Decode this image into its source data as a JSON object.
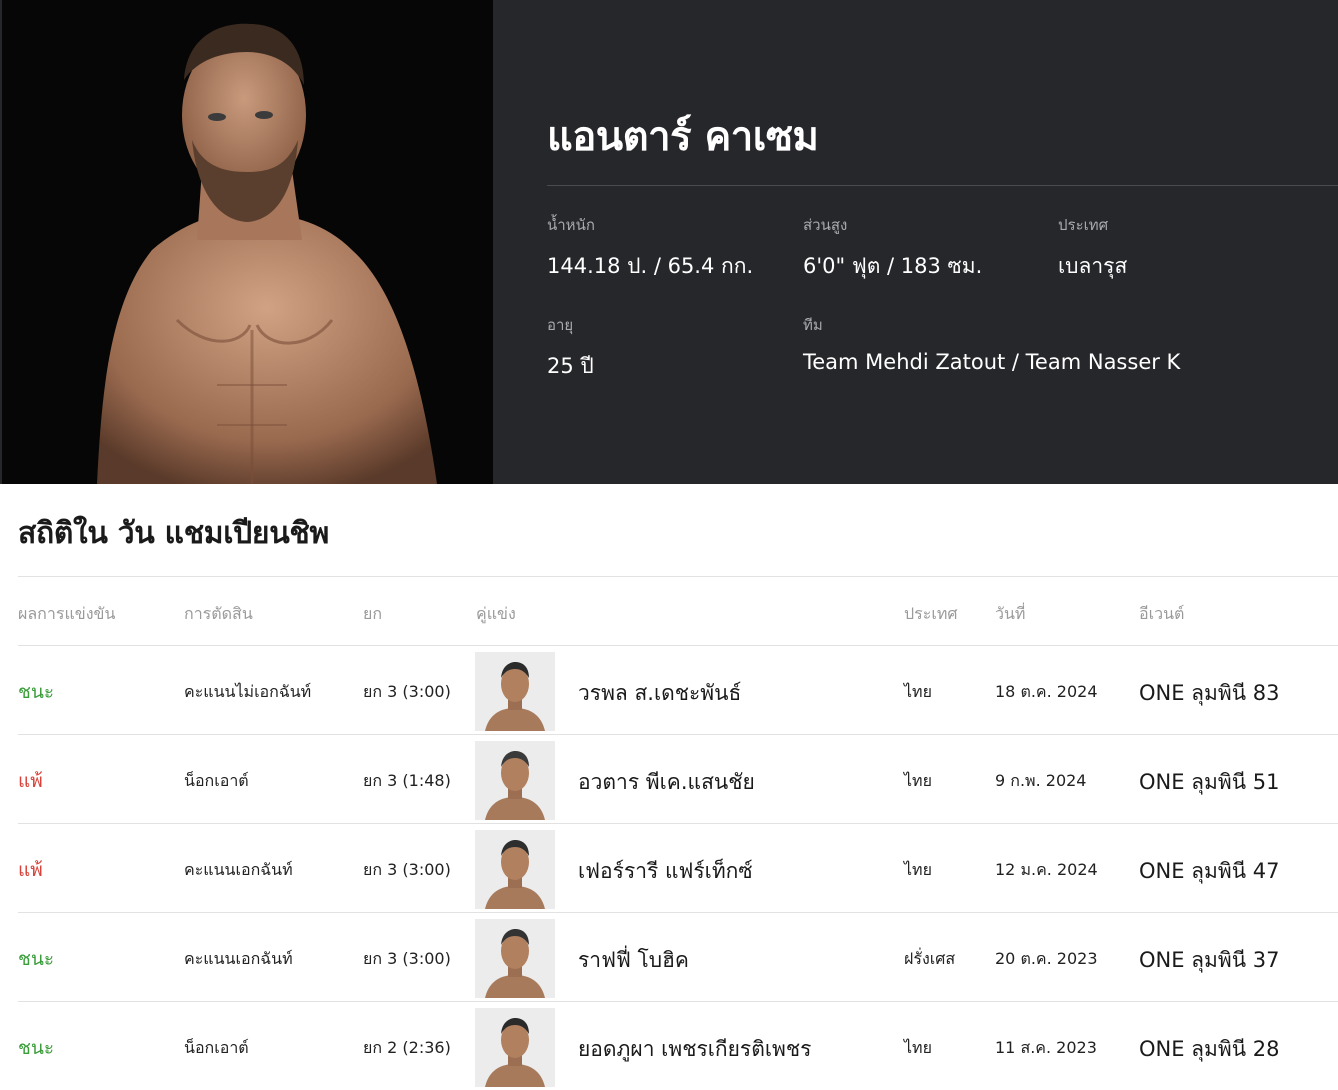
{
  "fighter": {
    "name": "แอนตาร์ คาเซม",
    "photo_alt": "fighter-portrait"
  },
  "stats": {
    "weight": {
      "label": "น้ำหนัก",
      "value": "144.18 ป. / 65.4 กก."
    },
    "height": {
      "label": "ส่วนสูง",
      "value": "6'0\" ฟุต / 183 ซม."
    },
    "country": {
      "label": "ประเทศ",
      "value": "เบลารุส"
    },
    "age": {
      "label": "อายุ",
      "value": "25 ปี"
    },
    "team": {
      "label": "ทีม",
      "value": "Team Mehdi Zatout / Team Nasser K"
    }
  },
  "record": {
    "title": "สถิติใน วัน แชมเปียนชิพ",
    "headers": {
      "result": "ผลการแข่งขัน",
      "method": "การตัดสิน",
      "round": "ยก",
      "opponent": "คู่แข่ง",
      "country": "ประเทศ",
      "date": "วันที่",
      "event": "อีเวนต์"
    },
    "rows": [
      {
        "result": "ชนะ",
        "result_type": "win",
        "method": "คะแนนไม่เอกฉันท์",
        "round": "ยก 3 (3:00)",
        "opponent": "วรพล ส.เดชะพันธ์",
        "country": "ไทย",
        "date": "18 ต.ค. 2024",
        "event": "ONE ลุมพินี 83"
      },
      {
        "result": "แพ้",
        "result_type": "loss",
        "method": "น็อกเอาต์",
        "round": "ยก 3 (1:48)",
        "opponent": "อวตาร พีเค.แสนชัย",
        "country": "ไทย",
        "date": "9 ก.พ. 2024",
        "event": "ONE ลุมพินี 51"
      },
      {
        "result": "แพ้",
        "result_type": "loss",
        "method": "คะแนนเอกฉันท์",
        "round": "ยก 3 (3:00)",
        "opponent": "เฟอร์รารี แฟร์เท็กซ์",
        "country": "ไทย",
        "date": "12 ม.ค. 2024",
        "event": "ONE ลุมพินี 47"
      },
      {
        "result": "ชนะ",
        "result_type": "win",
        "method": "คะแนนเอกฉันท์",
        "round": "ยก 3 (3:00)",
        "opponent": "ราฟฟี่ โบฮิค",
        "country": "ฝรั่งเศส",
        "date": "20 ต.ค. 2023",
        "event": "ONE ลุมพินี 37"
      },
      {
        "result": "ชนะ",
        "result_type": "win",
        "method": "น็อกเอาต์",
        "round": "ยก 2 (2:36)",
        "opponent": "ยอดภูผา เพชรเกียรติเพชร",
        "country": "ไทย",
        "date": "11 ส.ค. 2023",
        "event": "ONE ลุมพินี 28"
      }
    ]
  },
  "colors": {
    "hero_bg": "#26272b",
    "win": "#3a9d3a",
    "loss": "#d9423a"
  }
}
